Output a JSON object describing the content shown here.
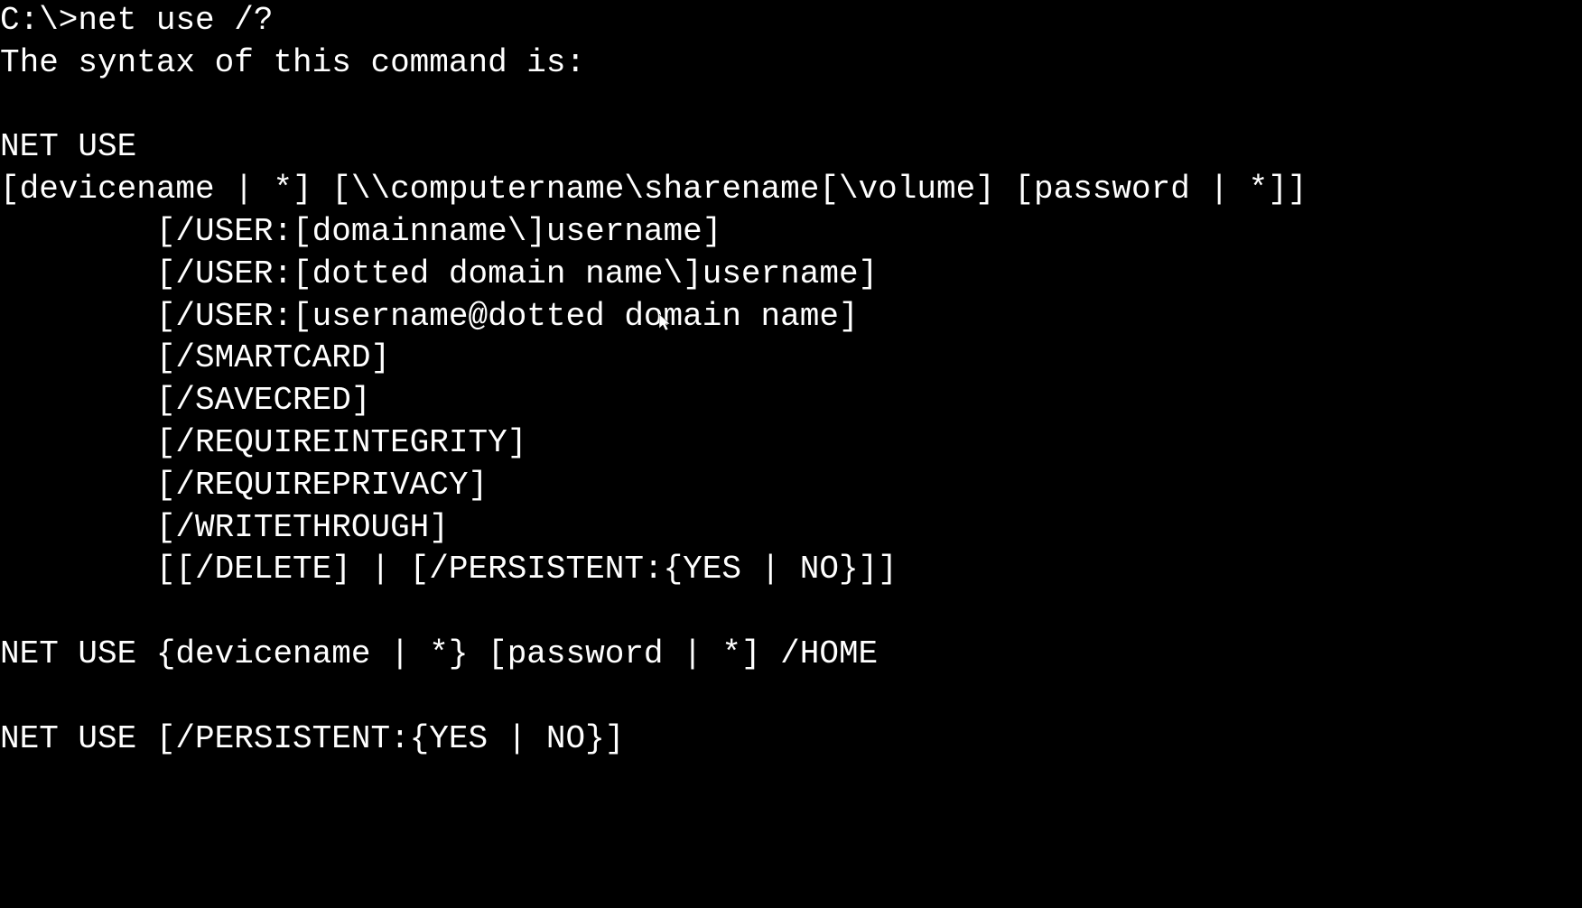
{
  "terminal": {
    "prompt": "C:\\>",
    "command": "net use /?",
    "lines": [
      "The syntax of this command is:",
      "",
      "NET USE",
      "[devicename | *] [\\\\computername\\sharename[\\volume] [password | *]]",
      "        [/USER:[domainname\\]username]",
      "        [/USER:[dotted domain name\\]username]",
      "        [/USER:[username@dotted domain name]",
      "        [/SMARTCARD]",
      "        [/SAVECRED]",
      "        [/REQUIREINTEGRITY]",
      "        [/REQUIREPRIVACY]",
      "        [/WRITETHROUGH]",
      "        [[/DELETE] | [/PERSISTENT:{YES | NO}]]",
      "",
      "NET USE {devicename | *} [password | *] /HOME",
      "",
      "NET USE [/PERSISTENT:{YES | NO}]"
    ]
  }
}
